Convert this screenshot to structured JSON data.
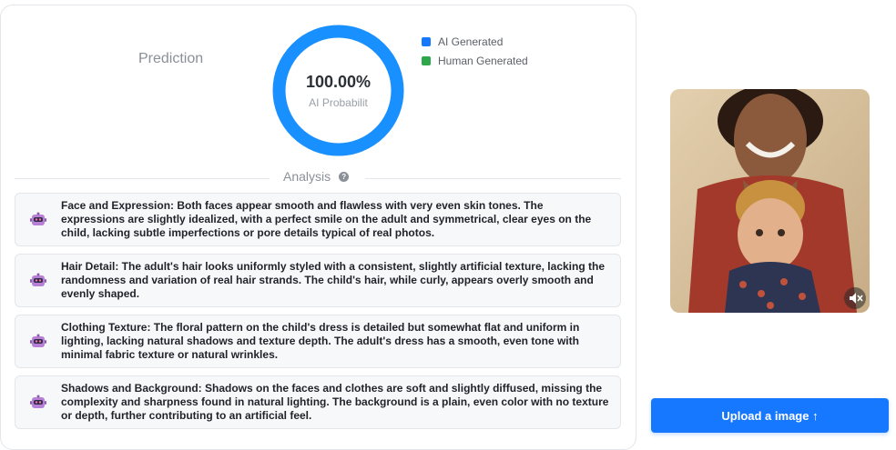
{
  "prediction": {
    "label": "Prediction",
    "value": "100.00%",
    "caption": "AI Probabilit",
    "ai_probability": 1.0
  },
  "legend": [
    {
      "label": "AI Generated",
      "color": "#1677ff"
    },
    {
      "label": "Human Generated",
      "color": "#2ea64a"
    }
  ],
  "analysis": {
    "title": "Analysis",
    "help_icon": "question-circle-icon",
    "items": [
      {
        "icon": "robot-icon",
        "text": "Face and Expression: Both faces appear smooth and flawless with very even skin tones. The expressions are slightly idealized, with a perfect smile on the adult and symmetrical, clear eyes on the child, lacking subtle imperfections or pore details typical of real photos."
      },
      {
        "icon": "robot-icon",
        "text": "Hair Detail: The adult's hair looks uniformly styled with a consistent, slightly artificial texture, lacking the randomness and variation of real hair strands. The child's hair, while curly, appears overly smooth and evenly shaped."
      },
      {
        "icon": "robot-icon",
        "text": "Clothing Texture: The floral pattern on the child's dress is detailed but somewhat flat and uniform in lighting, lacking natural shadows and texture depth. The adult's dress has a smooth, even tone with minimal fabric texture or natural wrinkles."
      },
      {
        "icon": "robot-icon",
        "text": "Shadows and Background: Shadows on the faces and clothes are soft and slightly diffused, missing the complexity and sharpness found in natural lighting. The background is a plain, even color with no texture or depth, further contributing to an artificial feel."
      }
    ]
  },
  "preview": {
    "mute_icon": "mute-icon"
  },
  "upload": {
    "label": "Upload a image ↑"
  }
}
